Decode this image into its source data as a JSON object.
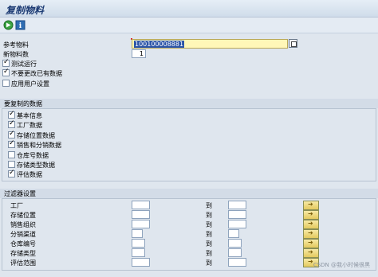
{
  "title": "复制物料",
  "toolbar": {
    "execute_icon": "execute-icon",
    "info_icon": "info-icon",
    "info_glyph": "i"
  },
  "form": {
    "reference_label": "参考物料",
    "reference_value": "100100008881",
    "new_count_label": "新物料数",
    "new_count_value": "1",
    "checkboxes": [
      {
        "label": "测试运行",
        "checked": true
      },
      {
        "label": "不要更改已有数据",
        "checked": true
      },
      {
        "label": "应用用户设置",
        "checked": false
      }
    ]
  },
  "copy_section": {
    "title": "要复制的数据",
    "items": [
      {
        "label": "基本信息",
        "checked": true
      },
      {
        "label": "工厂数据",
        "checked": true
      },
      {
        "label": "存储位置数据",
        "checked": true
      },
      {
        "label": "销售和分销数据",
        "checked": true
      },
      {
        "label": "仓库号数据",
        "checked": false
      },
      {
        "label": "存储类型数据",
        "checked": false
      },
      {
        "label": "评估数据",
        "checked": true
      }
    ]
  },
  "filter_section": {
    "title": "过滤器设置",
    "to_label": "到",
    "rows": [
      {
        "label": "工厂"
      },
      {
        "label": "存储位置"
      },
      {
        "label": "销售组织"
      },
      {
        "label": "分销渠道"
      },
      {
        "label": "仓库编号"
      },
      {
        "label": "存储类型"
      },
      {
        "label": "评估范围"
      }
    ]
  },
  "watermark": "CSDN @我小时候很黑"
}
